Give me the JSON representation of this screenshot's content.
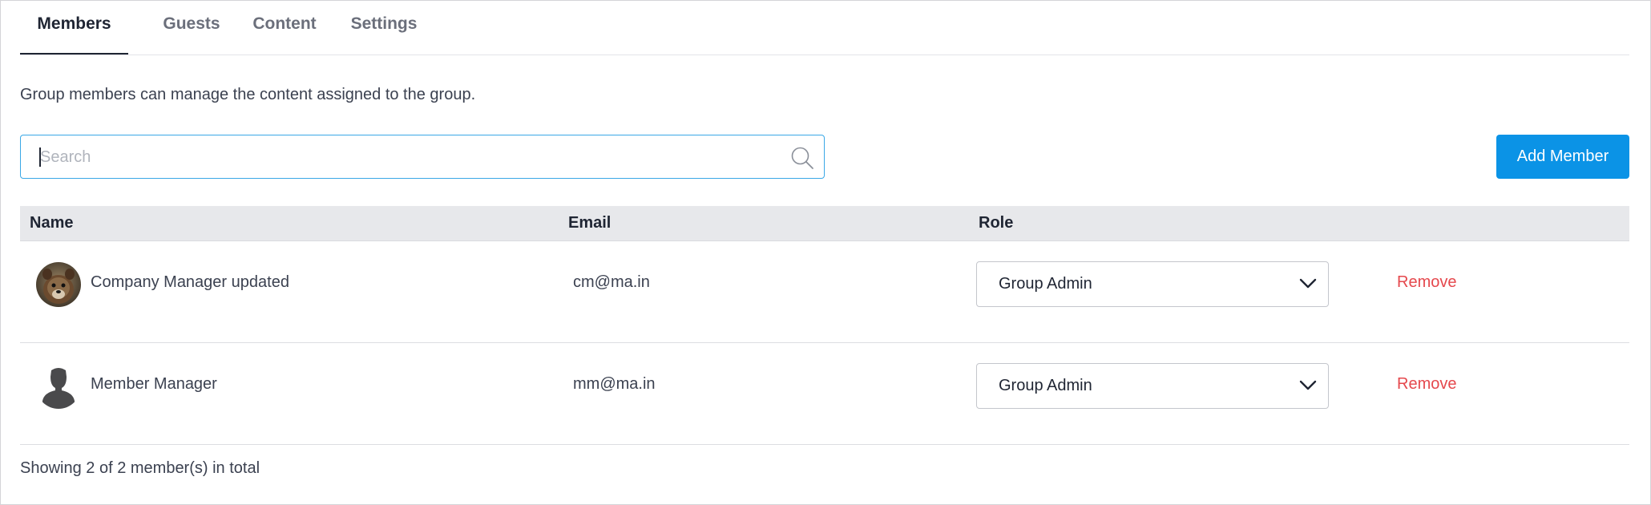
{
  "tabs": [
    {
      "label": "Members",
      "active": true
    },
    {
      "label": "Guests",
      "active": false
    },
    {
      "label": "Content",
      "active": false
    },
    {
      "label": "Settings",
      "active": false
    }
  ],
  "description": "Group members can manage the content assigned to the group.",
  "search": {
    "placeholder": "Search",
    "value": ""
  },
  "add_button": {
    "label": "Add Member"
  },
  "table": {
    "headers": {
      "name": "Name",
      "email": "Email",
      "role": "Role"
    },
    "rows": [
      {
        "name": "Company Manager updated",
        "email": "cm@ma.in",
        "role": "Group Admin",
        "action": "Remove",
        "avatar": "photo-avatar"
      },
      {
        "name": "Member Manager",
        "email": "mm@ma.in",
        "role": "Group Admin",
        "action": "Remove",
        "avatar": "default-user-avatar"
      }
    ]
  },
  "footer": {
    "summary": "Showing 2 of 2 member(s) in total"
  },
  "colors": {
    "primary": "#0b93e6",
    "danger": "#e5484d",
    "header_bg": "#e7e8eb",
    "focus_border": "#3aa8e6"
  }
}
